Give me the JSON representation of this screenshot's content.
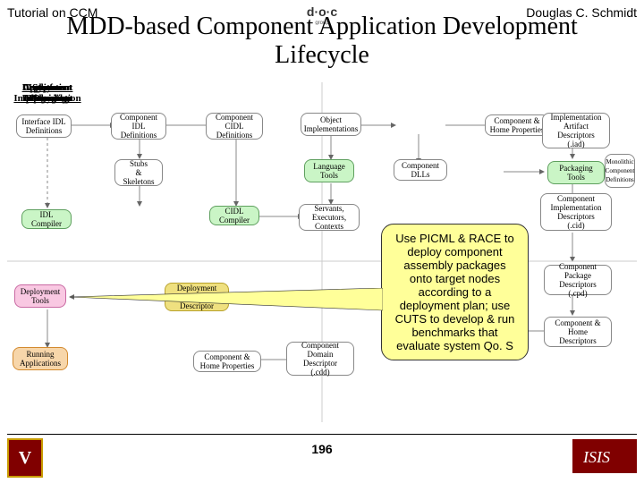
{
  "header": {
    "left": "Tutorial on CCM",
    "right": "Douglas C. Schmidt",
    "title_line1": "MDD-based Component Application Development",
    "title_line2": "Lifecycle"
  },
  "page_number": "196",
  "columns": {
    "interface_design": "Interface\nDesign",
    "component_design": "Component\nDesign",
    "component_implementation": "Component\nImplementation",
    "component_packaging": "Component\nPackaging",
    "system_deployment": "System\nDeployment",
    "deployment_planning": "Deployment\nPlanning",
    "system_integration": "System\nIntegration",
    "application_assembly": "Application\nAssembly"
  },
  "boxes": {
    "iface_idl": "Interface IDL\nDefinitions",
    "idl_compiler": "IDL\nCompiler",
    "comp_idl_def": "Component\nIDL\nDefinitions",
    "stubs_skel": "Stubs\n&\nSkeletons",
    "comp_cidl": "Component\nCIDL\nDefinitions",
    "cidl_compiler": "CIDL\nCompiler",
    "obj_impl": "Object\nImplementations",
    "lang_tools": "Language\nTools",
    "servants_exec": "Servants,\nExecutors,\nContexts",
    "comp_dlls": "Component\nDLLs",
    "comp_home_props": "Component &\nHome Properties",
    "impl_artifact": "Implementation\nArtifact\nDescriptors\n(.iad)",
    "packaging_tools": "Packaging\nTools",
    "comp_impl_desc": "Component\nImplementation\nDescriptors\n(.cid)",
    "monolithic_comp": "Monolithic\nComponent\nDefinitions",
    "comp_pkg_desc": "Component\nPackage\nDescriptors\n(.cpd)",
    "comp_assem_pkg": "Component &\nHome\nDescriptors",
    "assembly_tools": "Component\nDomain\nDescriptor\n(.cdd)",
    "deploy_plan": "Deployment\nPlan\nDescriptor",
    "deploy_tools": "Deployment\nTools",
    "running_apps": "Running\nApplications",
    "comp_home2": "Component &\nHome Properties"
  },
  "callout": {
    "text": "Use PICML & RACE to deploy component assembly packages onto target nodes according to a deployment plan; use CUTS to develop & run benchmarks that evaluate system Qo. S"
  },
  "logos": {
    "isis": "ISIS",
    "v": "V"
  }
}
